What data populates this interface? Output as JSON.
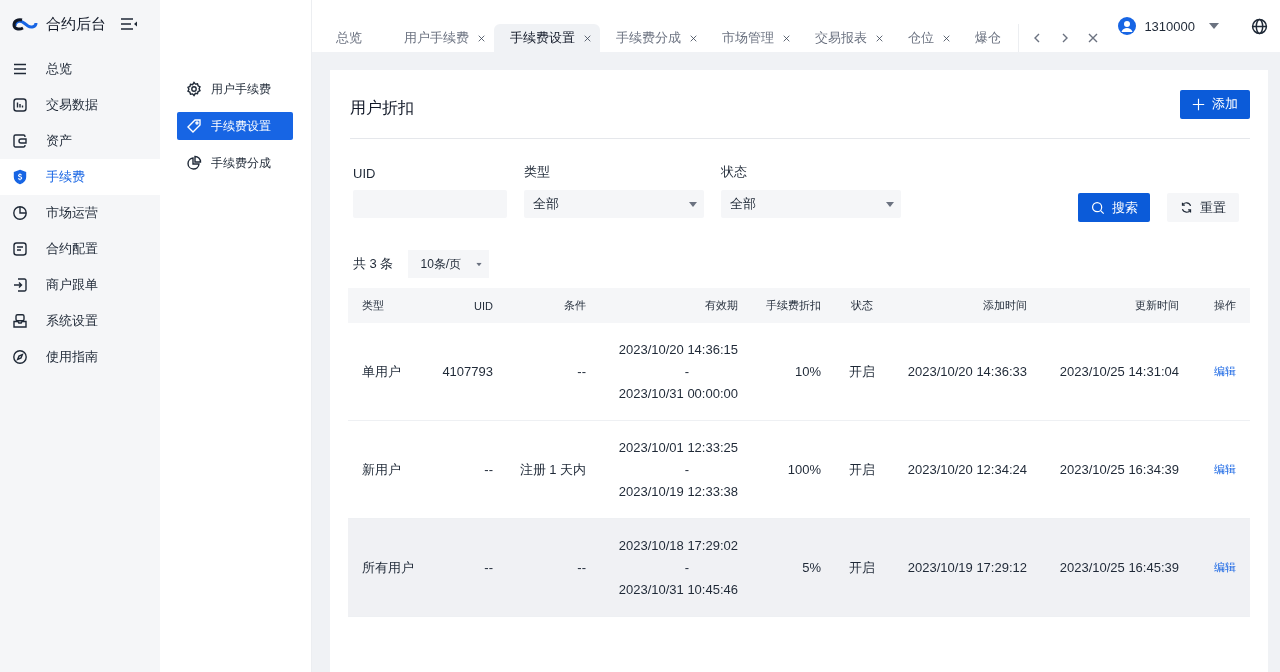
{
  "sidebar": {
    "logo": "合约后台",
    "items": [
      {
        "label": "总览",
        "selected": false
      },
      {
        "label": "交易数据",
        "selected": false
      },
      {
        "label": "资产",
        "selected": false
      },
      {
        "label": "手续费",
        "selected": true
      },
      {
        "label": "市场运营",
        "selected": false
      },
      {
        "label": "合约配置",
        "selected": false
      },
      {
        "label": "商户跟单",
        "selected": false
      },
      {
        "label": "系统设置",
        "selected": false
      },
      {
        "label": "使用指南",
        "selected": false
      }
    ]
  },
  "submenu": {
    "items": [
      {
        "label": "用户手续费",
        "selected": false
      },
      {
        "label": "手续费设置",
        "selected": true
      },
      {
        "label": "手续费分成",
        "selected": false
      }
    ]
  },
  "tabs": [
    {
      "label": "总览",
      "selected": false,
      "closable": false
    },
    {
      "label": "用户手续费",
      "selected": false,
      "closable": true
    },
    {
      "label": "手续费设置",
      "selected": true,
      "closable": true
    },
    {
      "label": "手续费分成",
      "selected": false,
      "closable": true
    },
    {
      "label": "市场管理",
      "selected": false,
      "closable": true
    },
    {
      "label": "交易报表",
      "selected": false,
      "closable": true
    },
    {
      "label": "仓位",
      "selected": false,
      "closable": true
    },
    {
      "label": "爆仓",
      "selected": false,
      "closable": false
    }
  ],
  "user": {
    "name": "1310000"
  },
  "page": {
    "title": "用户折扣",
    "add_button": "添加",
    "filters": [
      {
        "kind": "input",
        "label": "UID"
      },
      {
        "kind": "select",
        "label": "类型",
        "value": "全部"
      },
      {
        "kind": "select",
        "label": "状态",
        "value": "全部"
      }
    ],
    "search_button": "搜索",
    "reset_button": "重置",
    "total": "共 3 条",
    "page_size": "10条/页"
  },
  "table": {
    "columns": [
      "类型",
      "UID",
      "条件",
      "有效期",
      "手续费折扣",
      "状态",
      "添加时间",
      "更新时间",
      "操作"
    ],
    "rows": [
      {
        "highlighted": false,
        "type": "单用户",
        "uid": "4107793",
        "condition": "--",
        "validity_start": "2023/10/20 14:36:15",
        "validity_separator": "-",
        "validity_end": "2023/10/31 00:00:00",
        "discount": "10%",
        "status": "开启",
        "added": "2023/10/20 14:36:33",
        "updated": "2023/10/25 14:31:04",
        "action": "编辑"
      },
      {
        "highlighted": false,
        "type": "新用户",
        "uid": "--",
        "condition": "注册 1 天内",
        "validity_start": "2023/10/01 12:33:25",
        "validity_separator": "-",
        "validity_end": "2023/10/19 12:33:38",
        "discount": "100%",
        "status": "开启",
        "added": "2023/10/20 12:34:24",
        "updated": "2023/10/25 16:34:39",
        "action": "编辑"
      },
      {
        "highlighted": true,
        "type": "所有用户",
        "uid": "--",
        "condition": "--",
        "validity_start": "2023/10/18 17:29:02",
        "validity_separator": "-",
        "validity_end": "2023/10/31 10:45:46",
        "discount": "5%",
        "status": "开启",
        "added": "2023/10/19 17:29:12",
        "updated": "2023/10/25 16:45:39",
        "action": "编辑"
      }
    ]
  }
}
